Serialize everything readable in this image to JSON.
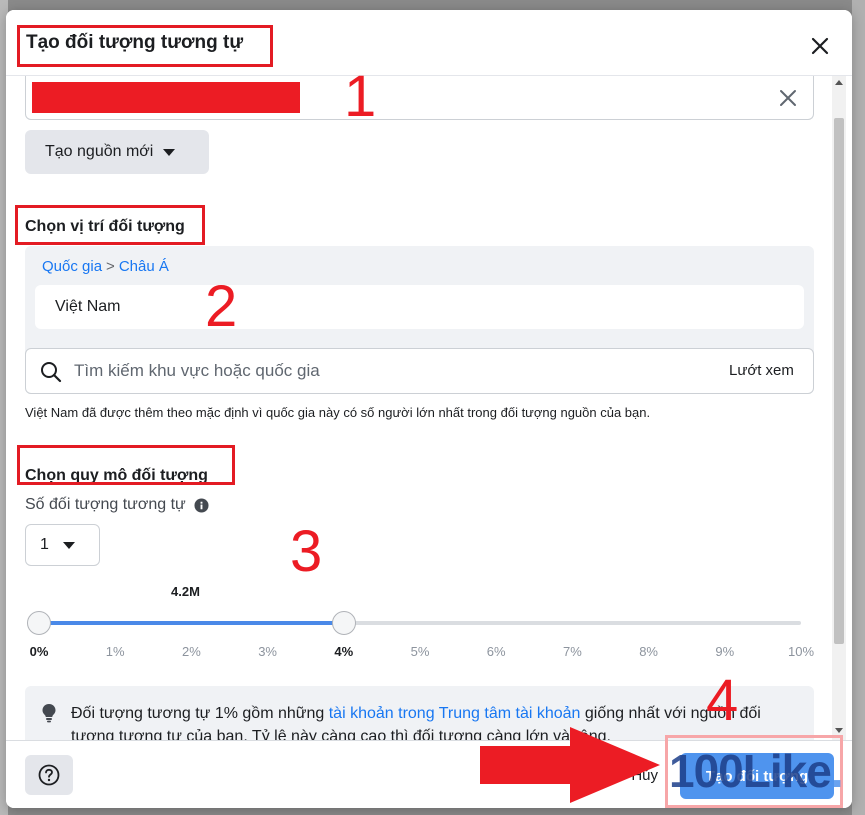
{
  "dialog": {
    "title": "Tạo đối tượng tương tự"
  },
  "source": {
    "new_source_label": "Tạo nguồn mới"
  },
  "location": {
    "section_title": "Chọn vị trí đối tượng",
    "breadcrumb": {
      "root": "Quốc gia",
      "separator": ">",
      "region": "Châu Á"
    },
    "selected_country": "Việt Nam",
    "search_placeholder": "Tìm kiếm khu vực hoặc quốc gia",
    "browse_label": "Lướt xem",
    "note": "Việt Nam đã được thêm theo mặc định vì quốc gia này có số người lớn nhất trong đối tượng nguồn của bạn."
  },
  "size": {
    "section_title": "Chọn quy mô đối tượng",
    "count_label": "Số đối tượng tương tự",
    "count_value": "1",
    "slider_value_label": "4.2M",
    "slider_min_percent": 0,
    "slider_max_percent": 4,
    "ticks": [
      "0%",
      "1%",
      "2%",
      "3%",
      "4%",
      "5%",
      "6%",
      "7%",
      "8%",
      "9%",
      "10%"
    ]
  },
  "tip": {
    "text_before": "Đối tượng tương tự 1% gồm những ",
    "link": "tài khoản trong Trung tâm tài khoản",
    "text_after": " giống nhất với nguồn đối tượng tương tự của bạn. Tỷ lệ này càng cao thì đối tượng càng lớn và rộng."
  },
  "footer": {
    "cancel_label": "Hủy",
    "create_label": "Tạo đối tượng"
  },
  "annotations": {
    "step1": "1",
    "step2": "2",
    "step3": "3",
    "step4": "4",
    "watermark_main": "100Like",
    "watermark_dot": "."
  },
  "colors": {
    "accent": "#1877f2",
    "primary_button": "#4f94ee",
    "slider_fill": "#4a89e8",
    "annotation_red": "#e31b23"
  },
  "icons": {
    "close": "close-icon",
    "clear": "clear-icon",
    "search": "search-icon",
    "info": "info-icon",
    "tip": "lightbulb-icon",
    "help": "help-icon"
  }
}
